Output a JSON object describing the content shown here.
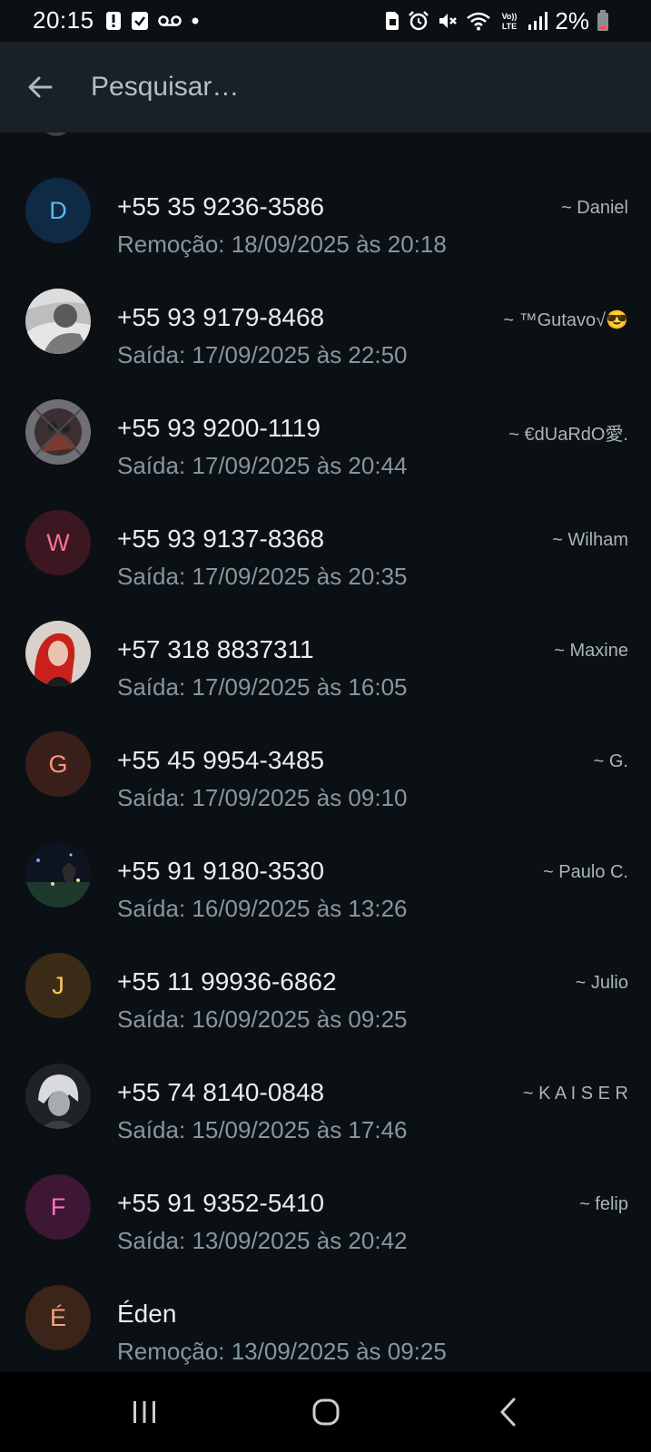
{
  "status_bar": {
    "time": "20:15",
    "battery": "2%",
    "icons_left": [
      "alert-icon",
      "check-box-icon",
      "voicemail-icon",
      "dot-icon"
    ],
    "icons_right": [
      "sim-icon",
      "alarm-icon",
      "mute-icon",
      "wifi-icon",
      "volte-icon",
      "signal-icon",
      "battery-icon"
    ]
  },
  "header": {
    "search_placeholder": "Pesquisar…",
    "back_icon": "arrow-left-icon"
  },
  "contacts": [
    {
      "primary": "+55 35 9236-3586",
      "secondary": "Remoção: 18/09/2025 às 20:18",
      "pushname": "~ Daniel",
      "avatar_letter": "D",
      "avatar_bg": "#0f2a44",
      "avatar_fg": "#53bdeb"
    },
    {
      "primary": "+55 93 9179-8468",
      "secondary": "Saída: 17/09/2025 às 22:50",
      "pushname": "~ ™Gutavo√😎",
      "avatar_letter": "",
      "avatar_photo": "grayscale-photo"
    },
    {
      "primary": "+55 93 9200-1119",
      "secondary": "Saída: 17/09/2025 às 20:44",
      "pushname": "~ €dUaRdO愛.",
      "avatar_letter": "",
      "avatar_photo": "dark-figure-photo"
    },
    {
      "primary": "+55 93 9137-8368",
      "secondary": "Saída: 17/09/2025 às 20:35",
      "pushname": "~ Wilham",
      "avatar_letter": "W",
      "avatar_bg": "#3b1721",
      "avatar_fg": "#fb7191"
    },
    {
      "primary": "+57 318 8837311",
      "secondary": "Saída: 17/09/2025 às 16:05",
      "pushname": "~ Maxine",
      "avatar_letter": "",
      "avatar_photo": "red-hair-photo"
    },
    {
      "primary": "+55 45 9954-3485",
      "secondary": "Saída: 17/09/2025 às 09:10",
      "pushname": "~ G.",
      "avatar_letter": "G",
      "avatar_bg": "#3b1f1a",
      "avatar_fg": "#fc9775"
    },
    {
      "primary": "+55 91 9180-3530",
      "secondary": "Saída: 16/09/2025 às 13:26",
      "pushname": "~ Paulo C.",
      "avatar_letter": "",
      "avatar_photo": "night-scene-photo"
    },
    {
      "primary": "+55 11 99936-6862",
      "secondary": "Saída: 16/09/2025 às 09:25",
      "pushname": "~ Julio",
      "avatar_letter": "J",
      "avatar_bg": "#3a2c17",
      "avatar_fg": "#ffca57"
    },
    {
      "primary": "+55 74 8140-0848",
      "secondary": "Saída: 15/09/2025 às 17:46",
      "pushname": "~ K A I S E R",
      "avatar_letter": "",
      "avatar_photo": "anime-photo"
    },
    {
      "primary": "+55 91 9352-5410",
      "secondary": "Saída: 13/09/2025 às 20:42",
      "pushname": "~ felip",
      "avatar_letter": "F",
      "avatar_bg": "#3d1733",
      "avatar_fg": "#ff72c4"
    },
    {
      "primary": "Éden",
      "secondary": "Remoção: 13/09/2025 às 09:25",
      "pushname": "",
      "avatar_letter": "É",
      "avatar_bg": "#3b2419",
      "avatar_fg": "#f7a37e"
    }
  ],
  "nav_bar": {
    "recents_icon": "recent-apps-icon",
    "home_icon": "home-icon",
    "back_icon": "back-chevron-icon"
  }
}
